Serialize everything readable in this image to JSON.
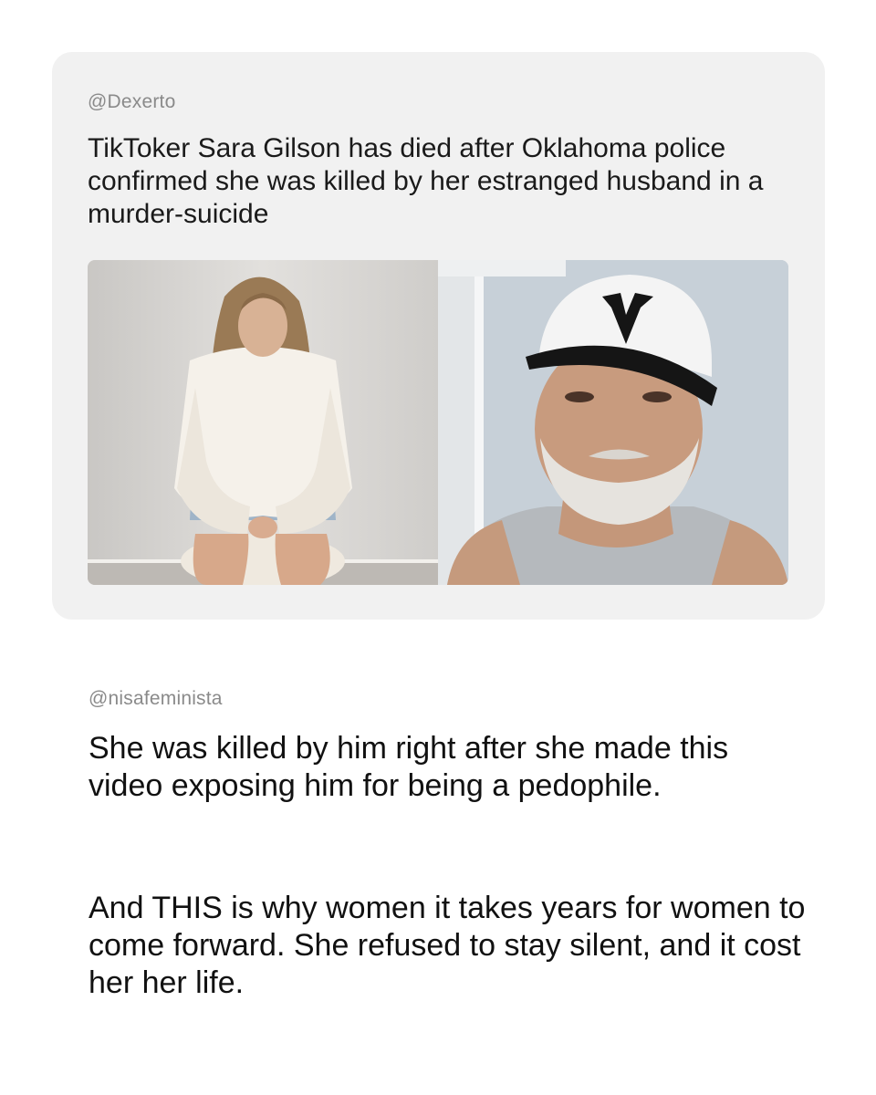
{
  "quoted_post": {
    "handle": "@Dexerto",
    "headline": "TikToker Sara Gilson has died after Oklahoma police confirmed she was killed by her estranged husband in a murder-suicide",
    "images": [
      {
        "subject": "woman-seated-white-hoodie"
      },
      {
        "subject": "man-white-cap-selfie"
      }
    ]
  },
  "post": {
    "handle": "@nisafeminista",
    "paragraphs": [
      "She was killed by him right after she made this video exposing him for being a pedophile.",
      "And THIS is why women it takes years for women to come forward. She refused to stay silent, and it cost her her life."
    ]
  },
  "colors": {
    "card_background": "#f1f1f1",
    "handle_text": "#8a8a8a",
    "body_text": "#111111",
    "page_background": "#ffffff"
  }
}
